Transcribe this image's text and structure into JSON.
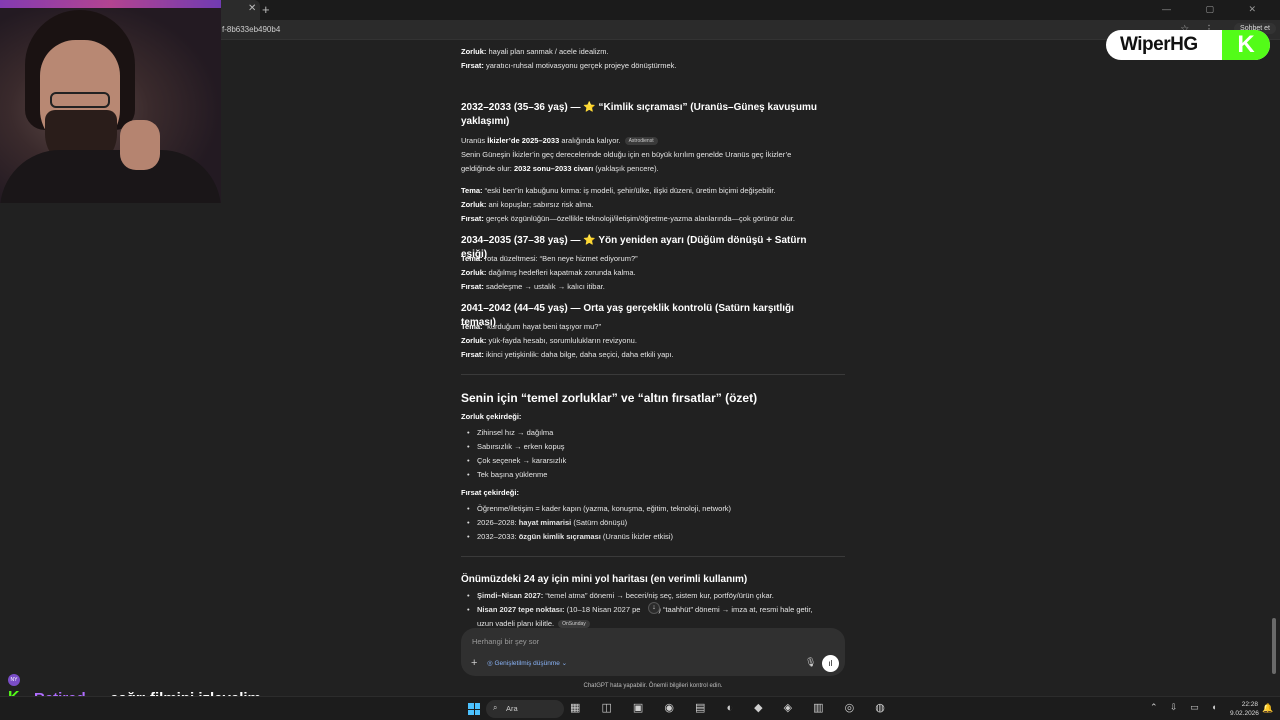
{
  "browser": {
    "tab_title": "",
    "tab_close": "✕",
    "new_tab": "+",
    "window_controls": "— ▢ ✕",
    "url": "f-8b633eb490b4",
    "address_icons": "☆ ⋮",
    "share_label": "Sohbet et"
  },
  "logo": {
    "text": "WiperHG",
    "k": "K"
  },
  "content": {
    "l1": {
      "label": "Zorluk:",
      "text": " hayali plan sanmak / acele idealizm."
    },
    "l2": {
      "label": "Fırsat:",
      "text": " yaratıcı-ruhsal motivasyonu gerçek projeye dönüştürmek."
    },
    "s1": {
      "heading": "2032–2033 (35–36 yaş) — ⭐ “Kimlik sıçraması” (Uranüs–Güneş kavuşumu yaklaşımı)",
      "p1_pre": "Uranüs ",
      "p1_b": "İkizler’de 2025–2033",
      "p1_post": " aralığında kalıyor.",
      "p1_pill": "Astrodienst",
      "p2": "Senin Güneşin İkizler’in geç derecelerinde olduğu için en büyük kırılım genelde Uranüs geç İkizler’e",
      "p3_pre": "geldiğinde olur: ",
      "p3_b": "2032 sonu–2033 civarı",
      "p3_post": " (yaklaşık pencere).",
      "tema_label": "Tema:",
      "tema": " “eski ben”in kabuğunu kırma: iş modeli, şehir/ülke, ilişki düzeni, üretim biçimi değişebilir.",
      "zorluk_label": "Zorluk:",
      "zorluk": " ani kopuşlar; sabırsız risk alma.",
      "firsat_label": "Fırsat:",
      "firsat": " gerçek özgünlüğün—özellikle teknoloji/iletişim/öğretme-yazma alanlarında—çok görünür olur."
    },
    "s2": {
      "heading": "2034–2035 (37–38 yaş) — ⭐ Yön yeniden ayarı (Düğüm dönüşü + Satürn eşiği)",
      "tema_label": "Tema:",
      "tema": " rota düzeltmesi: “Ben neye hizmet ediyorum?”",
      "zorluk_label": "Zorluk:",
      "zorluk": " dağılmış hedefleri kapatmak zorunda kalma.",
      "firsat_label": "Fırsat:",
      "firsat": " sadeleşme → ustalık → kalıcı itibar."
    },
    "s3": {
      "heading": "2041–2042 (44–45 yaş) — Orta yaş gerçeklik kontrolü (Satürn karşıtlığı teması)",
      "tema_label": "Tema:",
      "tema": " “kurduğum hayat beni taşıyor mu?”",
      "zorluk_label": "Zorluk:",
      "zorluk": " yük-fayda hesabı, sorumlulukların revizyonu.",
      "firsat_label": "Fırsat:",
      "firsat": " ikinci yetişkinlik: daha bilge, daha seçici, daha etkili yapı."
    },
    "summary": {
      "heading": "Senin için “temel zorluklar” ve “altın fırsatlar” (özet)",
      "zorluk_title": "Zorluk çekirdeği:",
      "zorluk_items": [
        "Zihinsel hız → dağılma",
        "Sabırsızlık → erken kopuş",
        "Çok seçenek → kararsızlık",
        "Tek başına yüklenme"
      ],
      "firsat_title": "Fırsat çekirdeği:",
      "f1": "Öğrenme/iletişim = kader kapın (yazma, konuşma, eğitim, teknoloji, network)",
      "f2_pre": "2026–2028: ",
      "f2_b": "hayat mimarisi",
      "f2_post": " (Satürn dönüşü)",
      "f3_pre": "2032–2033: ",
      "f3_b": "özgün kimlik sıçraması",
      "f3_post": " (Uranüs İkizler etkisi)"
    },
    "roadmap": {
      "heading": "Önümüzdeki 24 ay için mini yol haritası (en verimli kullanım)",
      "r1_b": "Şimdi–Nisan 2027:",
      "r1": " “temel atma” dönemi → beceri/niş seç, sistem kur, portföy/ürün çıkar.",
      "r2_b": "Nisan 2027 tepe noktası:",
      "r2": " (10–18 Nisan 2027 pe",
      "r2_post": "esi) “taahhüt” dönemi → imza at, resmi hale getir,",
      "r3": "uzun vadeli planı kilitle.",
      "r3_pill": "OnSunday"
    }
  },
  "composer": {
    "placeholder": "Herhangi bir şey sor",
    "plus": "+",
    "tool": "◎ Genişletilmiş düşünme ⌄",
    "mic": "🎙",
    "voice": "ıl",
    "scroll_down": "↓"
  },
  "disclaimer": "ChatGPT hata yapabilir. Önemli bilgileri kontrol edin.",
  "stream_chat": {
    "platform": "K",
    "user": "Retired...",
    "message": "çağrı filmini izleyelim",
    "avatar": "NY"
  },
  "taskbar": {
    "search_label": "Ara",
    "search_icon": "⌕",
    "icons": "▦ ◫ ▣ ◉ ▤ ◐ ◆ ◈ ▥ ◎ ◍",
    "tray": "⌃ ⇩ ▭ ◖",
    "time": "22:28",
    "date": "9.02.2026",
    "notif": "🔔"
  },
  "colors": {
    "background": "#212121",
    "accent_kick": "#53fc18",
    "chat_user": "#b06dff"
  }
}
